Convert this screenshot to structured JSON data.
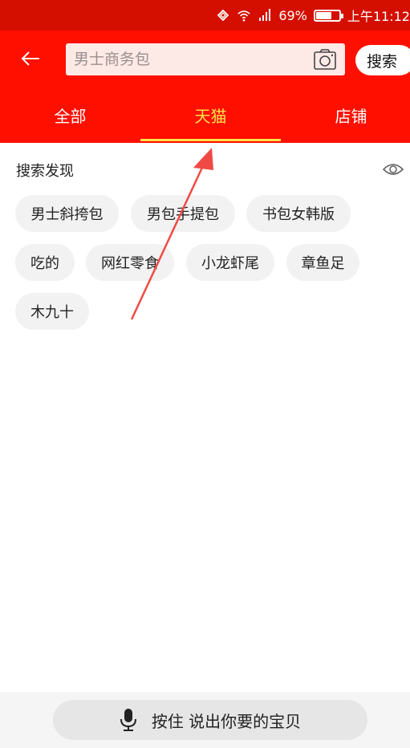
{
  "status_bar": {
    "battery": "69%",
    "battery_level": 0.69,
    "time": "上午11:12"
  },
  "header": {
    "search_placeholder": "男士商务包",
    "search_button": "搜索"
  },
  "tabs": [
    {
      "label": "全部",
      "active": false
    },
    {
      "label": "天猫",
      "active": true
    },
    {
      "label": "店铺",
      "active": false
    }
  ],
  "discovery": {
    "title": "搜索发现",
    "tags": [
      "男士斜挎包",
      "男包手提包",
      "书包女韩版",
      "吃的",
      "网红零食",
      "小龙虾尾",
      "章鱼足",
      "木九十"
    ]
  },
  "voice": {
    "label": "按住 说出你要的宝贝"
  },
  "colors": {
    "brand_red": "#ff0f00",
    "status_red": "#d40f00",
    "active_tab": "#ffe24a",
    "annotation_arrow": "#f04a44"
  },
  "icons": {
    "back": "arrow-left-icon",
    "camera": "camera-icon",
    "eye": "eye-icon",
    "mic": "microphone-icon"
  }
}
